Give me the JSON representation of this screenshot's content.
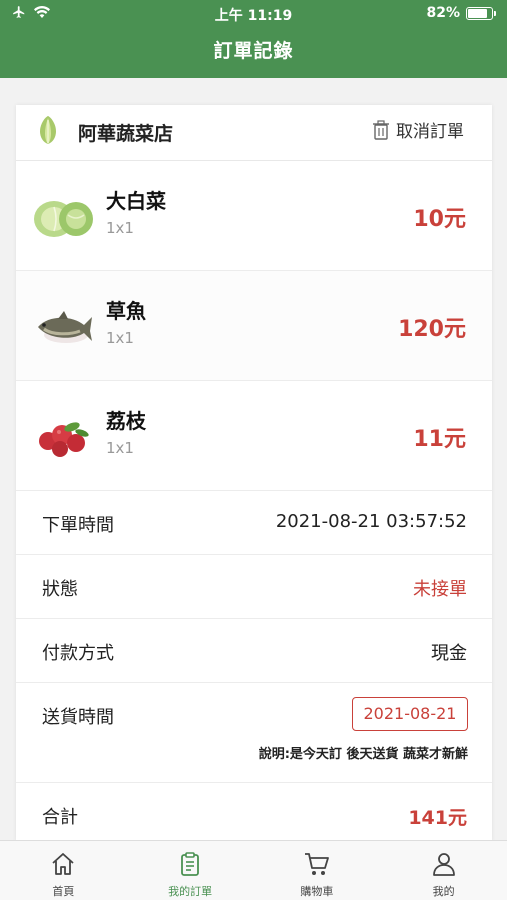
{
  "status_bar": {
    "time": "上午 11:19",
    "battery": "82%"
  },
  "header": {
    "title": "訂單記錄"
  },
  "store": {
    "name": "阿華蔬菜店",
    "cancel_label": "取消訂單"
  },
  "items": [
    {
      "name": "大白菜",
      "qty": "1x1",
      "price": "10元",
      "icon": "cabbage-image"
    },
    {
      "name": "草魚",
      "qty": "1x1",
      "price": "120元",
      "icon": "fish-image"
    },
    {
      "name": "荔枝",
      "qty": "1x1",
      "price": "11元",
      "icon": "lychee-image"
    }
  ],
  "info": {
    "order_time_label": "下單時間",
    "order_time": "2021-08-21 03:57:52",
    "status_label": "狀態",
    "status": "未接單",
    "payment_label": "付款方式",
    "payment": "現金",
    "delivery_label": "送貨時間",
    "delivery_date": "2021-08-21",
    "delivery_note": "說明:是今天訂 後天送貨 蔬菜才新鮮",
    "total_label": "合計",
    "total": "141元"
  },
  "tabs": [
    {
      "label": "首頁",
      "icon": "home-icon"
    },
    {
      "label": "我的訂單",
      "icon": "order-list-icon"
    },
    {
      "label": "購物車",
      "icon": "cart-icon"
    },
    {
      "label": "我的",
      "icon": "user-icon"
    }
  ],
  "colors": {
    "brand": "#4a9152",
    "accent_red": "#c9413a"
  }
}
